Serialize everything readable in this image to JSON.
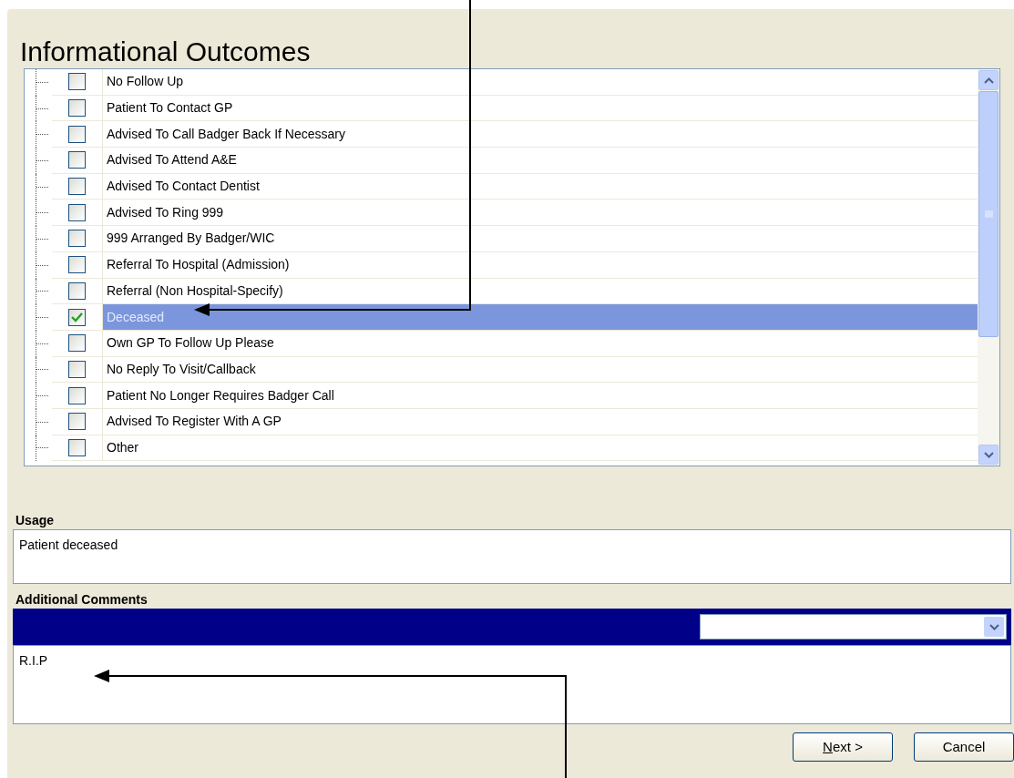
{
  "title": "Informational Outcomes",
  "outcomes": [
    {
      "label": "No Follow Up",
      "checked": false,
      "selected": false
    },
    {
      "label": "Patient To Contact GP",
      "checked": false,
      "selected": false
    },
    {
      "label": "Advised To Call Badger Back If Necessary",
      "checked": false,
      "selected": false
    },
    {
      "label": "Advised To Attend A&E",
      "checked": false,
      "selected": false
    },
    {
      "label": "Advised To Contact Dentist",
      "checked": false,
      "selected": false
    },
    {
      "label": "Advised To Ring 999",
      "checked": false,
      "selected": false
    },
    {
      "label": "999 Arranged By Badger/WIC",
      "checked": false,
      "selected": false
    },
    {
      "label": "Referral To Hospital (Admission)",
      "checked": false,
      "selected": false
    },
    {
      "label": "Referral (Non Hospital-Specify)",
      "checked": false,
      "selected": false
    },
    {
      "label": "Deceased",
      "checked": true,
      "selected": true
    },
    {
      "label": "Own GP To Follow Up Please",
      "checked": false,
      "selected": false
    },
    {
      "label": "No Reply To Visit/Callback",
      "checked": false,
      "selected": false
    },
    {
      "label": "Patient No Longer Requires Badger Call",
      "checked": false,
      "selected": false
    },
    {
      "label": "Advised To Register With A GP",
      "checked": false,
      "selected": false
    },
    {
      "label": "Other",
      "checked": false,
      "selected": false
    }
  ],
  "usage": {
    "label": "Usage",
    "value": "Patient deceased"
  },
  "comments": {
    "label": "Additional Comments",
    "value": "R.I.P"
  },
  "buttons": [
    {
      "label": "Next >",
      "mnemonic": true
    },
    {
      "label": "Cancel",
      "mnemonic": false
    }
  ]
}
